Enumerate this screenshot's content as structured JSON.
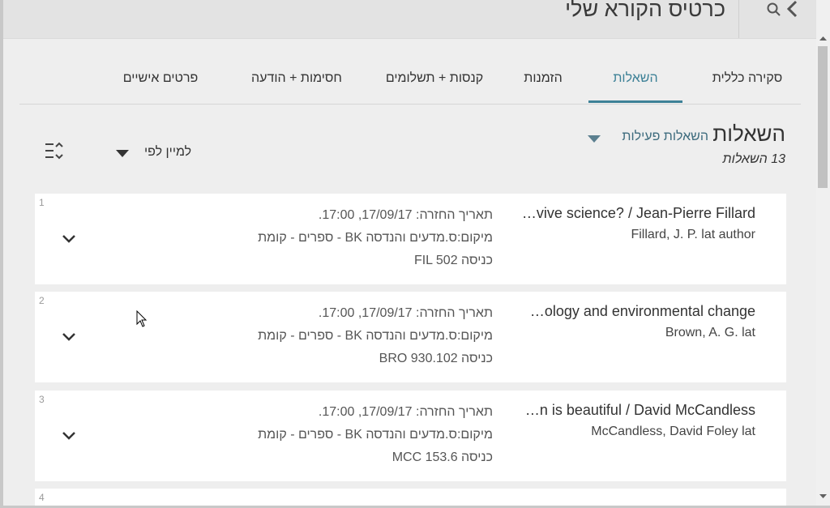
{
  "header": {
    "title": "כרטיס הקורא שלי",
    "search_icon": "search-icon",
    "back_icon": "chevron-left-icon"
  },
  "tabs": [
    {
      "label": "סקירה כללית",
      "active": false
    },
    {
      "label": "השאלות",
      "active": true
    },
    {
      "label": "הזמנות",
      "active": false
    },
    {
      "label": "קנסות + תשלומים",
      "active": false
    },
    {
      "label": "חסימות + הודעה",
      "active": false
    },
    {
      "label": "פרטים אישיים",
      "active": false
    }
  ],
  "loans": {
    "title": "השאלות",
    "filter_label": "השאלות פעילות",
    "count_label": "13 השאלות",
    "sort_label": "למיין לפי",
    "accent_color": "#3d8197",
    "items": [
      {
        "index": "1",
        "title": "…vive science? / Jean-Pierre Fillard",
        "author": "Fillard, J. P. lat author",
        "due": "תאריך החזרה: 17/09/17, 17:00.",
        "location": "מיקום:ס.מדעים והנדסה BK - ספרים - קומת",
        "call_number": "כניסה FIL 502"
      },
      {
        "index": "2",
        "title": "…ology and environmental change",
        "author": "Brown, A. G. lat",
        "due": "תאריך החזרה: 17/09/17, 17:00.",
        "location": "מיקום:ס.מדעים והנדסה BK - ספרים - קומת",
        "call_number": "כניסה BRO 930.102"
      },
      {
        "index": "3",
        "title": "…n is beautiful / David McCandless",
        "author": "McCandless, David Foley lat",
        "due": "תאריך החזרה: 17/09/17, 17:00.",
        "location": "מיקום:ס.מדעים והנדסה BK - ספרים - קומת",
        "call_number": "כניסה MCC 153.6"
      },
      {
        "index": "4"
      }
    ]
  }
}
